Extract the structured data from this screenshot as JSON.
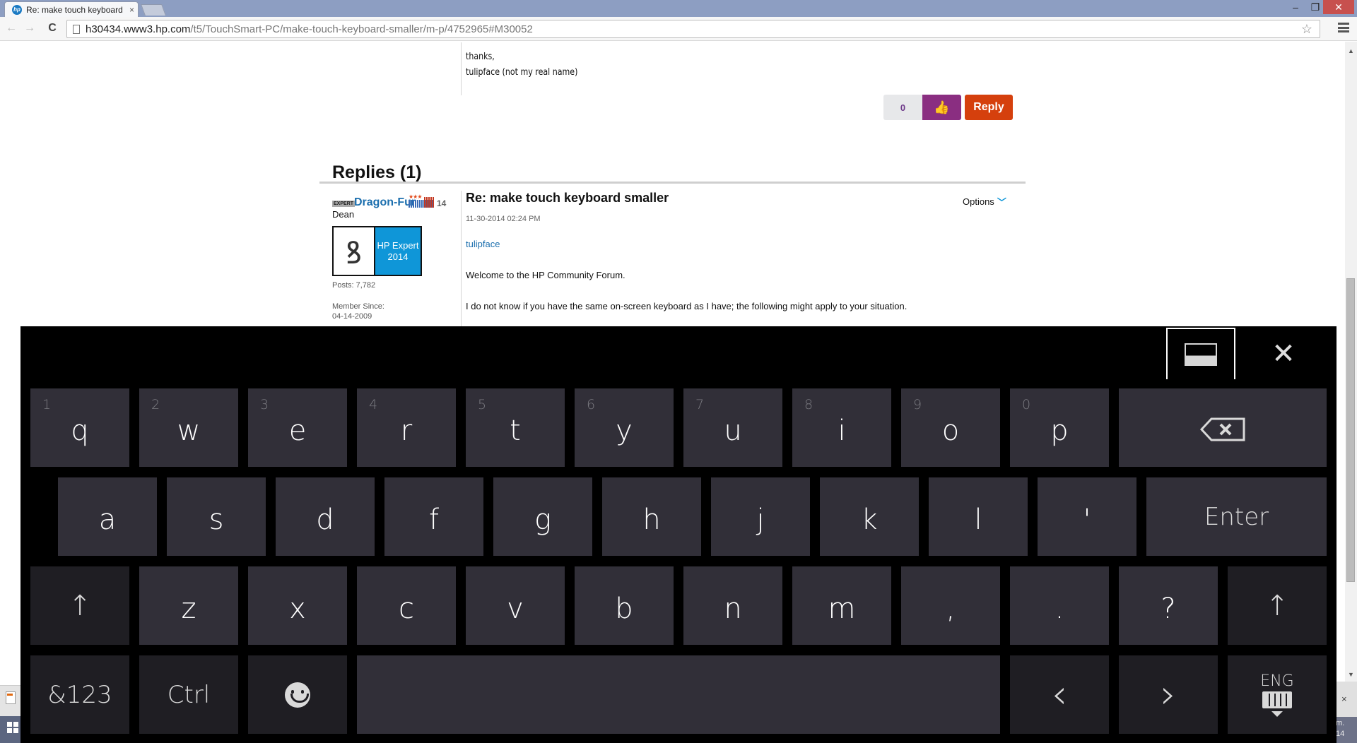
{
  "browser": {
    "tab_title": "Re: make touch keyboard",
    "tab_close": "×",
    "favicon_text": "hp",
    "url_host": "h30434.www3.hp.com",
    "url_path": "/t5/TouchSmart-PC/make-touch-keyboard-smaller/m-p/4752965#M30052",
    "window_controls": {
      "minimize": "–",
      "maximize": "❐",
      "close": "✕"
    },
    "nav": {
      "back": "←",
      "forward": "→",
      "reload": "C"
    },
    "star": "☆"
  },
  "original_post": {
    "lines": [
      "thanks,",
      "tulipface (not my real name)"
    ],
    "kudos_count": "0",
    "kudo_icon": "👍",
    "reply_label": "Reply"
  },
  "replies": {
    "heading": "Replies (1)",
    "items": [
      {
        "rank_badge": "EXPERT",
        "author": "Dragon-Fur",
        "rank_stars": "★★★",
        "kudos_total": "14",
        "real_name": "Dean",
        "avatar_art": "ꝸ",
        "avatar_tag_line1": "HP Expert",
        "avatar_tag_line2": "2014",
        "posts": "Posts: 7,782",
        "member_since_label": "Member Since:",
        "member_since": "04-14-2009",
        "subject": "Re: make touch keyboard smaller",
        "date": "11-30-2014 02:24 PM",
        "mention": "tulipface",
        "body": [
          "Welcome to the HP Community Forum.",
          "I do not know if you have the same on-screen keyboard as I have; the following might apply to your situation."
        ],
        "options_label": "Options",
        "options_chevron": "⌄"
      }
    ]
  },
  "touch_keyboard": {
    "dock_button": "dock-keyboard",
    "close_glyph": "✕",
    "row1": [
      {
        "num": "1",
        "char": "q"
      },
      {
        "num": "2",
        "char": "w"
      },
      {
        "num": "3",
        "char": "e"
      },
      {
        "num": "4",
        "char": "r"
      },
      {
        "num": "5",
        "char": "t"
      },
      {
        "num": "6",
        "char": "y"
      },
      {
        "num": "7",
        "char": "u"
      },
      {
        "num": "8",
        "char": "i"
      },
      {
        "num": "9",
        "char": "o"
      },
      {
        "num": "0",
        "char": "p"
      }
    ],
    "row2": [
      "a",
      "s",
      "d",
      "f",
      "g",
      "h",
      "j",
      "k",
      "l",
      "'"
    ],
    "enter_label": "Enter",
    "row3": [
      "z",
      "x",
      "c",
      "v",
      "b",
      "n",
      "m",
      ",",
      ".",
      "?"
    ],
    "shift_glyph": "🡑",
    "symbols_label": "&123",
    "ctrl_label": "Ctrl",
    "left_arrow": "‹",
    "right_arrow": "›",
    "language_label": "ENG"
  },
  "taskbar": {
    "right_text_line1": "m.",
    "right_text_line2": "14",
    "notification_close": "×"
  }
}
